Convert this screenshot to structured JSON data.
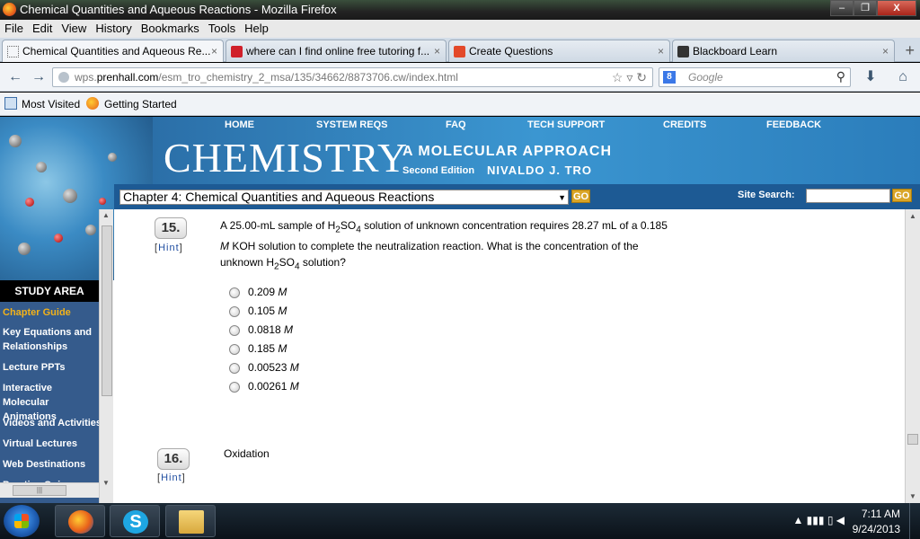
{
  "window": {
    "title": "Chemical Quantities and Aqueous Reactions - Mozilla Firefox",
    "minimize": "–",
    "maximize": "❐",
    "close": "X"
  },
  "menu": [
    "File",
    "Edit",
    "View",
    "History",
    "Bookmarks",
    "Tools",
    "Help"
  ],
  "tabs": [
    {
      "label": "Chemical Quantities and Aqueous Re...",
      "close": "×",
      "icon": "dotted-page-icon"
    },
    {
      "label": "where can I find online free tutoring f...",
      "close": "×",
      "icon": "ask-icon"
    },
    {
      "label": "Create Questions",
      "close": "×",
      "icon": "my-icon"
    },
    {
      "label": "Blackboard Learn",
      "close": "×",
      "icon": "blackboard-icon"
    }
  ],
  "new_tab": "+",
  "nav": {
    "back": "←",
    "forward": "→",
    "url_prefix": "wps.",
    "url_domain": "prenhall.com",
    "url_path": "/esm_tro_chemistry_2_msa/135/34662/8873706.cw/index.html",
    "url_icons": "☆ ▿ ↻",
    "search_engine": "8",
    "search_placeholder": "Google",
    "search_icon": "⚲",
    "download": "⬇",
    "home": "⌂"
  },
  "bookmarks": [
    "Most Visited",
    "Getting Started"
  ],
  "site": {
    "topnav": [
      "HOME",
      "SYSTEM REQS",
      "FAQ",
      "TECH SUPPORT",
      "CREDITS",
      "FEEDBACK"
    ],
    "brand": "CHEMISTRY",
    "subtitle": "A MOLECULAR APPROACH",
    "edition": "Second Edition",
    "author": "NIVALDO J. TRO",
    "chapter": "Chapter 4: Chemical Quantities and Aqueous Reactions",
    "go": "GO",
    "site_search_label": "Site Search:",
    "study_area": "STUDY AREA",
    "sidebar_items": [
      {
        "label": "Chapter Guide",
        "active": true
      },
      {
        "label": "Key Equations and Relationships",
        "active": false
      },
      {
        "label": "Lecture PPTs",
        "active": false
      },
      {
        "label": "Interactive Molecular Animations",
        "active": false
      },
      {
        "label": "Videos and Activities",
        "active": false
      },
      {
        "label": "Virtual Lectures",
        "active": false
      },
      {
        "label": "Web Destinations",
        "active": false
      },
      {
        "label": "Practice Quiz",
        "active": false
      }
    ]
  },
  "question15": {
    "number": "15.",
    "hint": "Hint",
    "text_a": "A 25.00-mL sample of H",
    "sub1": "2",
    "text_b": "SO",
    "sub2": "4",
    "text_c": " solution of unknown concentration requires 28.27 mL of a 0.185 ",
    "unit_m": "M",
    "text_d": " KOH solution to complete the neutralization reaction. What is the concentration of the unknown H",
    "sub3": "2",
    "text_e": "SO",
    "sub4": "4",
    "text_f": " solution?",
    "options": [
      {
        "value": "0.209",
        "unit": "M"
      },
      {
        "value": "0.105",
        "unit": "M"
      },
      {
        "value": "0.0818",
        "unit": "M"
      },
      {
        "value": "0.185",
        "unit": "M"
      },
      {
        "value": "0.00523",
        "unit": "M"
      },
      {
        "value": "0.00261",
        "unit": "M"
      }
    ]
  },
  "question16": {
    "number": "16.",
    "hint": "Hint",
    "text": "Oxidation"
  },
  "taskbar": {
    "time": "7:11 AM",
    "date": "9/24/2013",
    "tray": "▲ ▮▮▮ ▯ ◀"
  }
}
